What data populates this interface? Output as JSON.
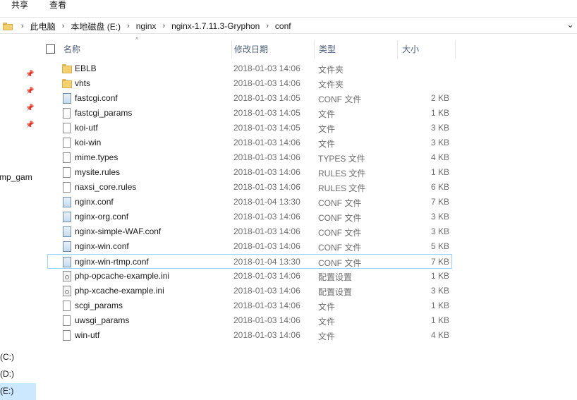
{
  "ribbon": {
    "tabs": [
      "共享",
      "查看"
    ]
  },
  "address": {
    "crumbs": [
      "此电脑",
      "本地磁盘 (E:)",
      "nginx",
      "nginx-1.7.11.3-Gryphon",
      "conf"
    ]
  },
  "sidebar": {
    "partial_item": "mp_gam",
    "drives": [
      "(C:)",
      "(D:)",
      "(E:)"
    ],
    "selected_drive": "(E:)"
  },
  "columns": {
    "name": "名称",
    "date": "修改日期",
    "type": "类型",
    "size": "大小"
  },
  "files": [
    {
      "name": "EBLB",
      "date": "2018-01-03 14:06",
      "type": "文件夹",
      "size": "",
      "icon": "folder"
    },
    {
      "name": "vhts",
      "date": "2018-01-03 14:06",
      "type": "文件夹",
      "size": "",
      "icon": "folder"
    },
    {
      "name": "fastcgi.conf",
      "date": "2018-01-03 14:05",
      "type": "CONF 文件",
      "size": "2 KB",
      "icon": "conf"
    },
    {
      "name": "fastcgi_params",
      "date": "2018-01-03 14:05",
      "type": "文件",
      "size": "1 KB",
      "icon": "file"
    },
    {
      "name": "koi-utf",
      "date": "2018-01-03 14:05",
      "type": "文件",
      "size": "3 KB",
      "icon": "file"
    },
    {
      "name": "koi-win",
      "date": "2018-01-03 14:06",
      "type": "文件",
      "size": "3 KB",
      "icon": "file"
    },
    {
      "name": "mime.types",
      "date": "2018-01-03 14:06",
      "type": "TYPES 文件",
      "size": "4 KB",
      "icon": "file"
    },
    {
      "name": "mysite.rules",
      "date": "2018-01-03 14:06",
      "type": "RULES 文件",
      "size": "1 KB",
      "icon": "file"
    },
    {
      "name": "naxsi_core.rules",
      "date": "2018-01-03 14:06",
      "type": "RULES 文件",
      "size": "6 KB",
      "icon": "file"
    },
    {
      "name": "nginx.conf",
      "date": "2018-01-04 13:30",
      "type": "CONF 文件",
      "size": "7 KB",
      "icon": "conf"
    },
    {
      "name": "nginx-org.conf",
      "date": "2018-01-03 14:06",
      "type": "CONF 文件",
      "size": "3 KB",
      "icon": "conf"
    },
    {
      "name": "nginx-simple-WAF.conf",
      "date": "2018-01-03 14:06",
      "type": "CONF 文件",
      "size": "3 KB",
      "icon": "conf"
    },
    {
      "name": "nginx-win.conf",
      "date": "2018-01-03 14:06",
      "type": "CONF 文件",
      "size": "5 KB",
      "icon": "conf"
    },
    {
      "name": "nginx-win-rtmp.conf",
      "date": "2018-01-04 13:30",
      "type": "CONF 文件",
      "size": "7 KB",
      "icon": "conf",
      "selected": true
    },
    {
      "name": "php-opcache-example.ini",
      "date": "2018-01-03 14:06",
      "type": "配置设置",
      "size": "1 KB",
      "icon": "ini"
    },
    {
      "name": "php-xcache-example.ini",
      "date": "2018-01-03 14:06",
      "type": "配置设置",
      "size": "3 KB",
      "icon": "ini"
    },
    {
      "name": "scgi_params",
      "date": "2018-01-03 14:06",
      "type": "文件",
      "size": "1 KB",
      "icon": "file"
    },
    {
      "name": "uwsgi_params",
      "date": "2018-01-03 14:06",
      "type": "文件",
      "size": "1 KB",
      "icon": "file"
    },
    {
      "name": "win-utf",
      "date": "2018-01-03 14:06",
      "type": "文件",
      "size": "4 KB",
      "icon": "file"
    }
  ]
}
